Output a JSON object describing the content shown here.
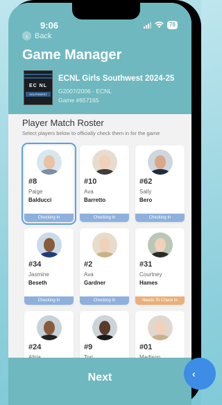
{
  "status_bar": {
    "time": "9:06",
    "battery": "78"
  },
  "nav": {
    "back_label": "Back"
  },
  "header": {
    "title": "Game Manager",
    "logo_text": "EC NL",
    "logo_sub": "SOUTHWEST",
    "event_name": "ECNL Girls Southwest 2024-25",
    "age_group": "G2007/2006 - ECNL",
    "game_number": "Game #657165"
  },
  "roster": {
    "title": "Player Match Roster",
    "subtitle": "Select players below to officially check them in for the game",
    "players": [
      {
        "number": "#8",
        "first": "Paige",
        "last": "Balducci",
        "status": "Checking In"
      },
      {
        "number": "#10",
        "first": "Ava",
        "last": "Barretto",
        "status": "Checking In"
      },
      {
        "number": "#62",
        "first": "Sally",
        "last": "Bero",
        "status": "Checking In"
      },
      {
        "number": "#34",
        "first": "Jasmine",
        "last": "Beseth",
        "status": "Checking In"
      },
      {
        "number": "#2",
        "first": "Ava",
        "last": "Gardner",
        "status": "Checking In"
      },
      {
        "number": "#31",
        "first": "Courtney",
        "last": "Hames",
        "status": "Needs To Check In"
      },
      {
        "number": "#24",
        "first": "Aliria",
        "last": "",
        "status": ""
      },
      {
        "number": "#9",
        "first": "Tori",
        "last": "",
        "status": ""
      },
      {
        "number": "#01",
        "first": "Madison",
        "last": "",
        "status": ""
      }
    ]
  },
  "colors": {
    "header": "#6fb8bf",
    "checking_in": "#8fb0dc",
    "needs_check_in": "#e9b07a",
    "highlight": "#5aa0e6"
  },
  "footer": {
    "next_label": "Next"
  },
  "fab_icon": "chevron-left-icon"
}
